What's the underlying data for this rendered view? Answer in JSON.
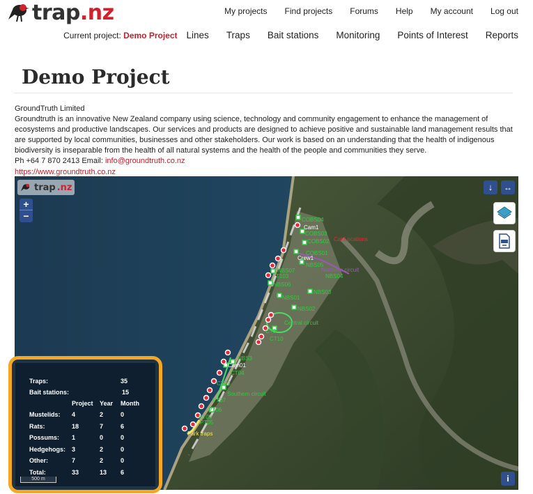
{
  "brand": {
    "name_main": "trap",
    "name_dot": ".nz"
  },
  "topnav": [
    "My projects",
    "Find projects",
    "Forums",
    "Help",
    "My account",
    "Log out"
  ],
  "subnav": {
    "current_label": "Current project:",
    "current_project": "Demo Project",
    "items": [
      "Lines",
      "Traps",
      "Bait stations",
      "Monitoring",
      "Points of Interest",
      "Reports"
    ]
  },
  "page": {
    "title": "Demo Project",
    "org": "GroundTruth Limited",
    "description": "Groundtruth is an innovative New Zealand company using science, technology and community engagement to enhance the management of ecosystems and productive landscapes. Our services and products are designed to achieve positive and sustainable land management results that are supported by local communities, businesses and other stakeholders. Our work is based on an understanding that the health of indigenous biodiversity is inseparable from the health of all natural systems and the health of the people and communities they serve.",
    "contact_prefix": "Ph +64 7 870 2413 Email: ",
    "email": "info@groundtruth.co.nz",
    "website": "https://www.groundtruth.co.nz"
  },
  "map": {
    "logo_main": "trap",
    "logo_dot": ".nz",
    "zoom_in": "+",
    "zoom_out": "−",
    "download_icon": "↓",
    "expand_icon": "↔",
    "info_icon": "i",
    "scale_label": "500 m",
    "labels": [
      "COBS04",
      "Cam1",
      "COBS03",
      "COBS02",
      "Cat Locations",
      "COBS01",
      "Crew1",
      "NBS05",
      "Northern circuit",
      "NBS07",
      "NBS04",
      "T103",
      "NBS06",
      "NBS03",
      "NBS01",
      "NBS02",
      "Central circuit",
      "CT3",
      "CT10",
      "NBS3",
      "Cam01",
      "CT04",
      "CT05",
      "Southern circuit",
      "PT07",
      "PT06",
      "PT03",
      "PT05",
      "Park traps"
    ]
  },
  "stats": {
    "traps_label": "Traps:",
    "traps_value": "35",
    "bait_label": "Bait stations:",
    "bait_value": "15",
    "col_project": "Project",
    "col_year": "Year",
    "col_month": "Month",
    "rows": [
      {
        "label": "Mustelids:",
        "project": "4",
        "year": "2",
        "month": "0"
      },
      {
        "label": "Rats:",
        "project": "18",
        "year": "7",
        "month": "6"
      },
      {
        "label": "Possums:",
        "project": "1",
        "year": "0",
        "month": "0"
      },
      {
        "label": "Hedgehogs:",
        "project": "3",
        "year": "2",
        "month": "0"
      },
      {
        "label": "Other:",
        "project": "7",
        "year": "2",
        "month": "0"
      },
      {
        "label": "Total:",
        "project": "33",
        "year": "13",
        "month": "6"
      }
    ]
  },
  "colors": {
    "brand_red": "#c2202c",
    "highlight_orange": "#f5a623",
    "map_button_blue": "#2f4f8f",
    "marker_green": "#2ecc40",
    "marker_red": "#e8283a"
  }
}
